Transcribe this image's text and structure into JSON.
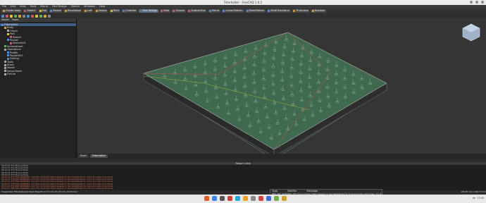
{
  "window": {
    "title": "Filterhalter - FreeCAD 1.0.2"
  },
  "menu": [
    "File",
    "Edit",
    "View",
    "Tools",
    "Macro",
    "Part Design",
    "Sketch",
    "Windows",
    "Help"
  ],
  "toolbar": {
    "buttons": [
      {
        "label": "Create body",
        "color": "#d9a441"
      },
      {
        "label": "Sketch",
        "color": "#d35b5b"
      },
      {
        "label": "Pad",
        "color": "#e7c23c"
      },
      {
        "label": "Pocket",
        "color": "#4a8fd8"
      },
      {
        "label": "Revolution",
        "color": "#d9a441"
      },
      {
        "label": "Loft",
        "color": "#d9a441"
      },
      {
        "label": "Sweep",
        "color": "#d9a441"
      },
      {
        "label": "Fillet",
        "color": "#e7c23c"
      },
      {
        "label": "Chamfer",
        "color": "#4a8fd8"
      },
      {
        "label": "Part Design",
        "color": "#5c6e82",
        "active": true
      },
      {
        "label": "Hole",
        "color": "#d35b5b"
      },
      {
        "label": "Groove",
        "color": "#d35b5b"
      },
      {
        "label": "Subtractive",
        "color": "#d35b5b"
      },
      {
        "label": "Mirror",
        "color": "#4a8fd8"
      },
      {
        "label": "LinearPattern",
        "color": "#4a8fd8"
      },
      {
        "label": "PolarPattern",
        "color": "#4a8fd8"
      },
      {
        "label": "MultiTransform",
        "color": "#4a8fd8"
      },
      {
        "label": "Thickness",
        "color": "#d9a441"
      },
      {
        "label": "Boolean",
        "color": "#d9a441"
      }
    ]
  },
  "sidebar": {
    "tabs": [
      "Model",
      "Tasks"
    ],
    "tree": [
      {
        "label": "Filterhalter",
        "depth": 0,
        "selected": true,
        "color": "#4a8fd8"
      },
      {
        "label": "Body",
        "depth": 1,
        "color": "#d9a441"
      },
      {
        "label": "Origin",
        "depth": 2,
        "color": "#aaa"
      },
      {
        "label": "Pad",
        "depth": 2,
        "color": "#e7c23c"
      },
      {
        "label": "Sketch",
        "depth": 3,
        "color": "#d35b5b"
      },
      {
        "label": "Pocket",
        "depth": 2,
        "color": "#4a8fd8"
      },
      {
        "label": "Sketch001",
        "depth": 3,
        "color": "#d35b5b"
      },
      {
        "label": "Spreadsheet",
        "depth": 1,
        "color": "#5fb35f"
      },
      {
        "label": "Operations",
        "depth": 1,
        "color": "#aaa"
      },
      {
        "label": "Profile",
        "depth": 2,
        "color": "#4a8fd8"
      },
      {
        "label": "Pocket001",
        "depth": 2,
        "color": "#4a8fd8"
      },
      {
        "label": "Drilling",
        "depth": 2,
        "color": "#4a8fd8"
      },
      {
        "label": "Tools",
        "depth": 1,
        "color": "#aaa"
      },
      {
        "label": "Stock",
        "depth": 1,
        "color": "#aaa"
      },
      {
        "label": "Model",
        "depth": 1,
        "color": "#aaa"
      },
      {
        "label": "SetupSheet",
        "depth": 1,
        "color": "#aaa"
      },
      {
        "label": "Fixture",
        "depth": 1,
        "color": "#aaa"
      }
    ]
  },
  "view_tabs": [
    "Start",
    "Filterhalter"
  ],
  "report": {
    "title": "Report view",
    "lines": [
      {
        "text": "09:14:27.371  Moving Node",
        "kind": "info"
      },
      {
        "text": "09:14:27.372  Moving Node",
        "kind": "info"
      },
      {
        "text": "09:14:27.372  Moving Node",
        "kind": "info"
      },
      {
        "text": "09:14:27.373  Moving Node",
        "kind": "info"
      },
      {
        "text": "09:14:27.373  Moving Node",
        "kind": "info"
      },
      {
        "text": "09:14:27.375  Path.WARNING: Add Tool Controller Rapid Speeds on the SetupSheet for more accurate cycle times.",
        "kind": "warn"
      },
      {
        "text": "09:14:27.376  Path.WARNING: Add Tool Controller Rapid Speeds on the SetupSheet for more accurate cycle times.",
        "kind": "warn"
      },
      {
        "text": "09:14:27.377  Path.WARNING: Add Tool Controller Rapid Speeds on the SetupSheet for more accurate cycle times.",
        "kind": "warn"
      },
      {
        "text": "09:14:27.378  Path.WARNING: Add Tool Controller Rapid Speeds on the SetupSheet for more accurate cycle times.",
        "kind": "warn"
      },
      {
        "text": "09:14:27.379  Path.WARNING: Add Tool Controller Rapid Speeds on the SetupSheet for more accurate cycle times.",
        "kind": "warn"
      },
      {
        "text": "09:14:27.380  Path.WARNING: Add Tool Controller Rapid Speeds on the SetupSheet for more accurate cycle times.",
        "kind": "warn"
      }
    ]
  },
  "notification": {
    "col_type": "Type",
    "col_notifier": "Notifier",
    "col_message": "Message",
    "row": "Path   Path.WARNING: Add Tool Controller Rapid Speeds on the SetupSheet for more accurate cycle times. (11 times)"
  },
  "statusbar": {
    "left": "Preselected: Filterhalter.Job.Stock.Edge35 (17.57 mm, 61.23 mm, 10.00 mm)",
    "right": "195.30 mm x 166.77 mm"
  },
  "taskbar": {
    "apps": [
      "#e05a2b",
      "#3b82f6",
      "#555",
      "#d23b3b",
      "#29a3d9",
      "#f0a020",
      "#888",
      "#d04040",
      "#3b6bd9",
      "#6fb04a",
      "#d0a030"
    ],
    "tray": [
      "de",
      "12:45"
    ]
  }
}
